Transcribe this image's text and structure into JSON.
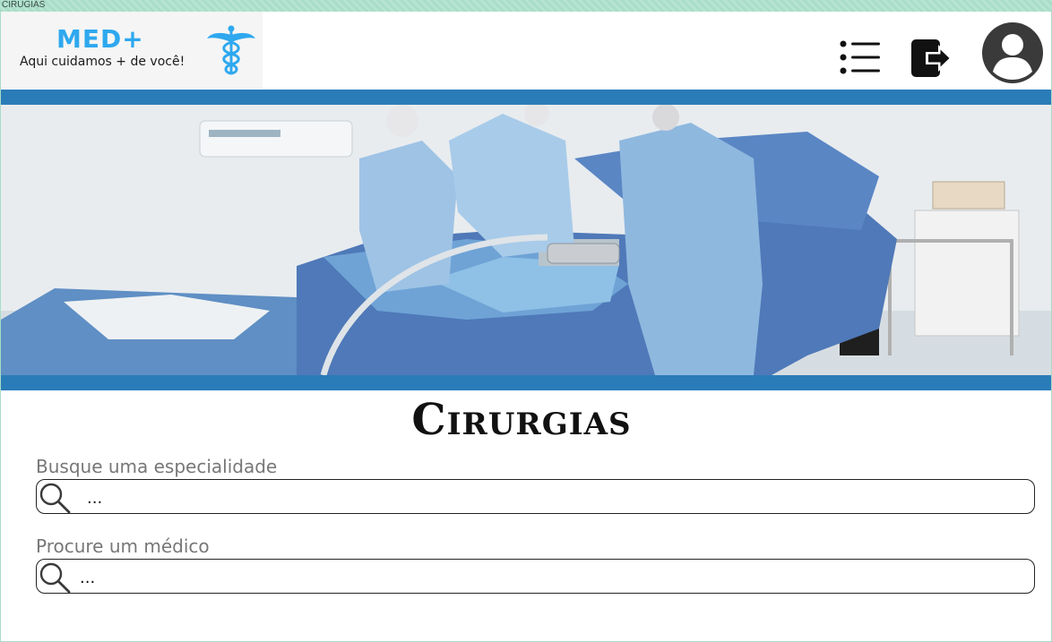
{
  "window": {
    "title": "CIRUGIAS"
  },
  "header": {
    "logo": {
      "title": "MED+",
      "tagline": "Aqui cuidamos + de você!",
      "symbol_icon": "caduceus-icon"
    },
    "menu_icon": "menu-list-icon",
    "logout_icon": "logout-icon",
    "profile_icon": "user-avatar-icon"
  },
  "hero": {
    "image": "operating-room-surgery-photo"
  },
  "colors": {
    "band": "#2a7cb8",
    "brand": "#2ea8ef",
    "frame_border": "#a8dcc8"
  },
  "main": {
    "title": "Cirurgias",
    "specialty_search": {
      "label": "Busque uma especialidade",
      "value": "..."
    },
    "doctor_search": {
      "label": "Procure um médico",
      "value": "..."
    }
  }
}
